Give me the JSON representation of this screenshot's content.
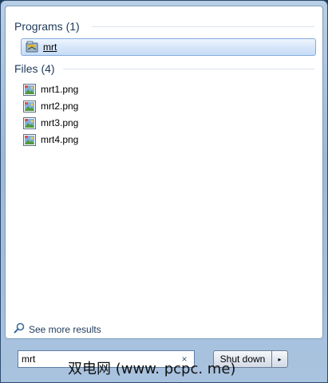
{
  "results": {
    "programs_header": "Programs (1)",
    "program_items": [
      {
        "label": "mrt",
        "icon": "mrt-app-icon"
      }
    ],
    "files_header": "Files (4)",
    "file_items": [
      {
        "label": "mrt1.png",
        "icon": "png-image-icon"
      },
      {
        "label": "mrt2.png",
        "icon": "png-image-icon"
      },
      {
        "label": "mrt3.png",
        "icon": "png-image-icon"
      },
      {
        "label": "mrt4.png",
        "icon": "png-image-icon"
      }
    ]
  },
  "see_more": {
    "label": "See more results",
    "icon": "search-icon"
  },
  "search": {
    "value": "mrt",
    "clear_glyph": "×"
  },
  "shutdown": {
    "label": "Shut down",
    "arrow_glyph": "▸"
  },
  "watermark": "双电网 (www. pcpc. me)",
  "colors": {
    "accent": "#1e395b",
    "selected_bg": "#d7e7fa",
    "frame": "#9db9d8"
  }
}
